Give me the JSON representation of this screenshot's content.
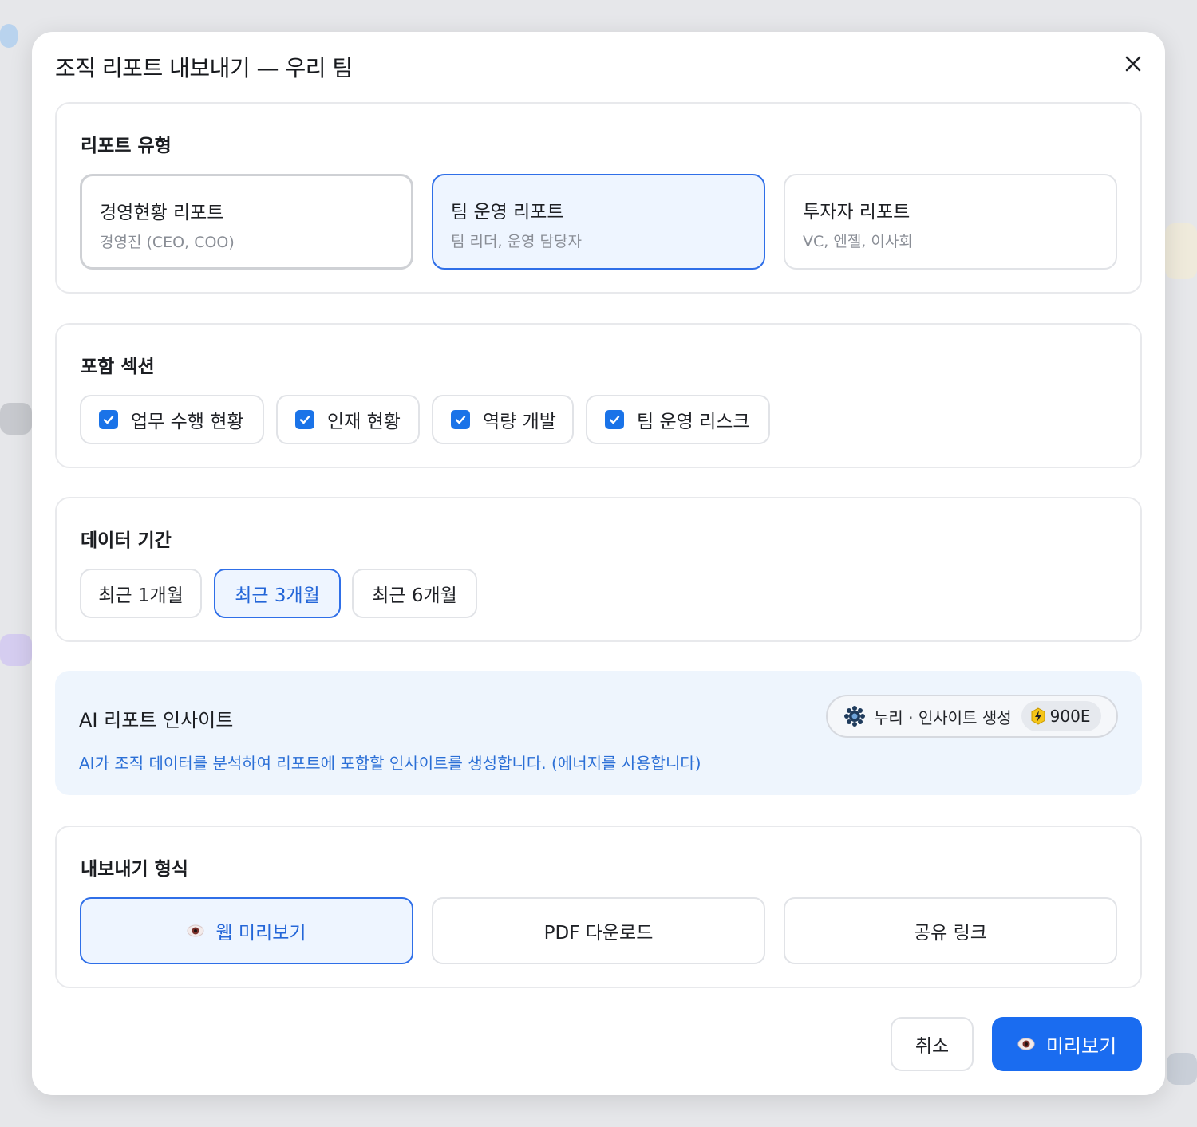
{
  "modal": {
    "title": "조직 리포트 내보내기 — 우리 팀"
  },
  "report_type": {
    "title": "리포트 유형",
    "options": [
      {
        "label": "경영현황 리포트",
        "desc": "경영진 (CEO, COO)"
      },
      {
        "label": "팀 운영 리포트",
        "desc": "팀 리더, 운영 담당자",
        "selected": true
      },
      {
        "label": "투자자 리포트",
        "desc": "VC, 엔젤, 이사회"
      }
    ]
  },
  "sections": {
    "title": "포함 섹션",
    "items": [
      {
        "label": "업무 수행 현황",
        "checked": true
      },
      {
        "label": "인재 현황",
        "checked": true
      },
      {
        "label": "역량 개발",
        "checked": true
      },
      {
        "label": "팀 운영 리스크",
        "checked": true
      }
    ]
  },
  "period": {
    "title": "데이터 기간",
    "options": [
      {
        "label": "최근 1개월"
      },
      {
        "label": "최근 3개월",
        "selected": true
      },
      {
        "label": "최근 6개월"
      }
    ]
  },
  "ai": {
    "title": "AI 리포트 인사이트",
    "description": "AI가 조직 데이터를 분석하여 리포트에 포함할 인사이트를 생성합니다. (에너지를 사용합니다)",
    "button_label": "누리 · 인사이트 생성",
    "energy_cost": "900E"
  },
  "format": {
    "title": "내보내기 형식",
    "options": [
      {
        "label": "웹 미리보기",
        "icon": "eye-icon",
        "selected": true
      },
      {
        "label": "PDF 다운로드"
      },
      {
        "label": "공유 링크"
      }
    ]
  },
  "footer": {
    "cancel_label": "취소",
    "primary_label": "미리보기",
    "primary_icon": "eye-icon"
  },
  "colors": {
    "accent": "#1a6cf0",
    "selected_bg": "#eef5ff",
    "ai_bg": "#eef5fd",
    "ai_text": "#2b6fd6"
  }
}
